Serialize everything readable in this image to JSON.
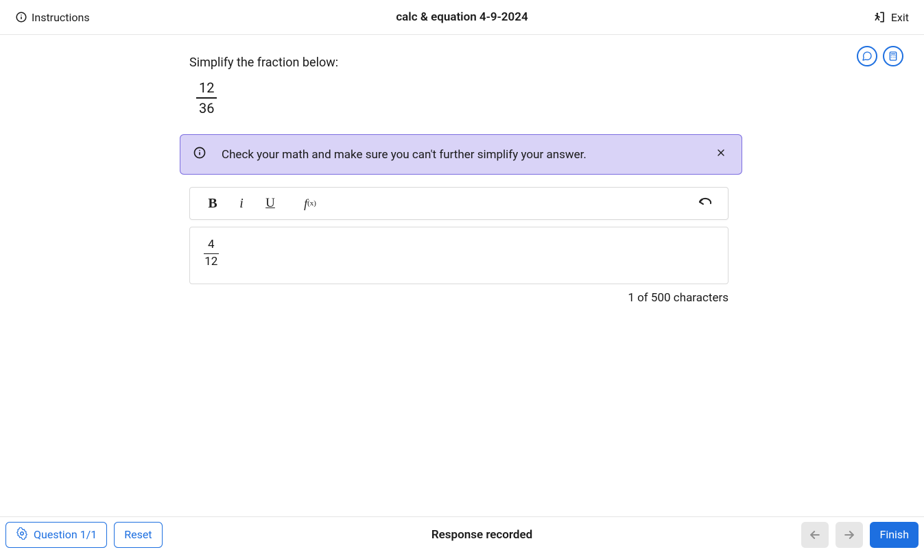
{
  "header": {
    "instructions_label": "Instructions",
    "title": "calc & equation 4-9-2024",
    "exit_label": "Exit"
  },
  "question": {
    "prompt": "Simplify the fraction below:",
    "fraction": {
      "numerator": "12",
      "denominator": "36"
    }
  },
  "hint": {
    "text": "Check your math and make sure you can't further simplify your answer."
  },
  "toolbar": {
    "bold": "B",
    "italic": "i",
    "underline": "U",
    "fx_main": "f",
    "fx_sub": "(x)"
  },
  "answer": {
    "fraction": {
      "numerator": "4",
      "denominator": "12"
    }
  },
  "char_count": "1 of 500 characters",
  "footer": {
    "question_label": "Question 1/1",
    "reset_label": "Reset",
    "status": "Response recorded",
    "finish_label": "Finish"
  }
}
